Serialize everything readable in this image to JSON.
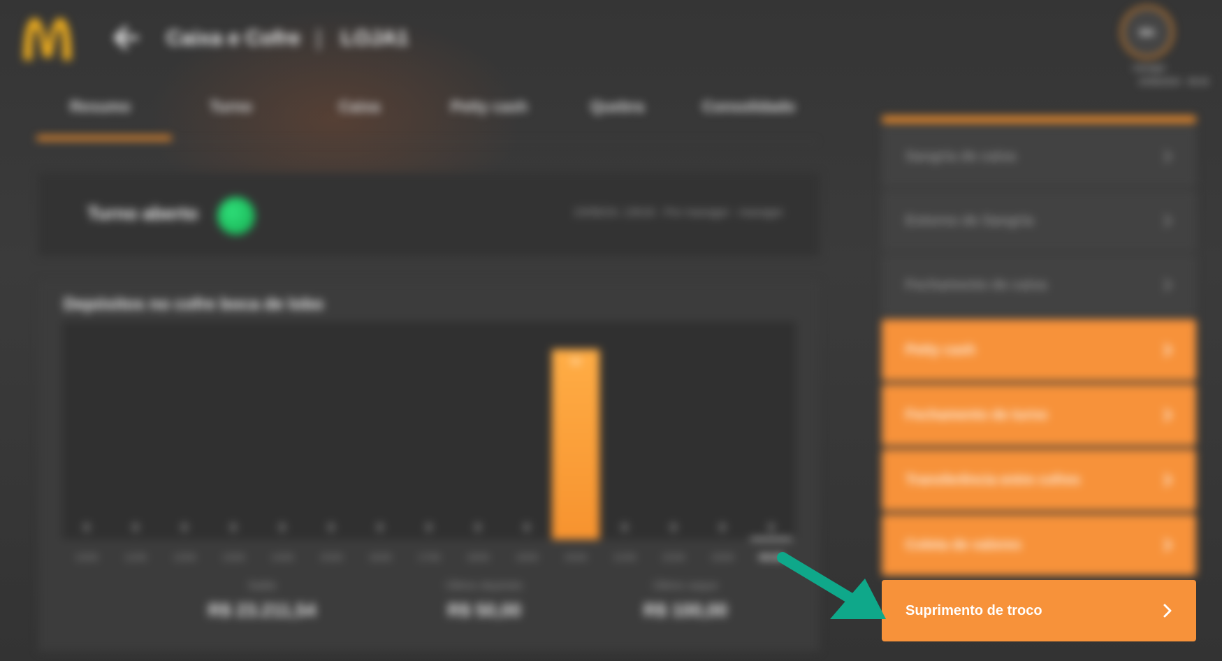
{
  "header": {
    "title": "Caixa e Cofre",
    "separator": "|",
    "store": "LOJA1",
    "user_initials": "MA",
    "user_role": "manager",
    "user_datetime": "23/06/2024 · 09:30"
  },
  "tabs": [
    "Resumo",
    "Turno",
    "Caixa",
    "Petty cash",
    "Quebra",
    "Consolidado"
  ],
  "active_tab": "Resumo",
  "shift": {
    "label": "Turno aberto",
    "info": "23/06/24, 13h16 - Por manager - manager"
  },
  "chart_card": {
    "title": "Depósitos no cofre boca de lobo",
    "stats": [
      {
        "label": "Saldo",
        "value": "R$ 23.211,54"
      },
      {
        "label": "Último depósito",
        "value": "R$ 50,00"
      },
      {
        "label": "Último saque",
        "value": "R$ 100,00"
      }
    ]
  },
  "chart_data": {
    "type": "bar",
    "categories": [
      "10/06",
      "11/06",
      "12/06",
      "13/06",
      "14/06",
      "15/06",
      "16/06",
      "17/06",
      "18/06",
      "19/06",
      "20/06",
      "21/06",
      "22/06",
      "23/06",
      "HOJE"
    ],
    "values": [
      0,
      0,
      0,
      0,
      0,
      0,
      0,
      0,
      0,
      0,
      50,
      0,
      0,
      0,
      0
    ],
    "bar_color": "#f7932f"
  },
  "menu": {
    "accent_color": "#e98a2c",
    "items": [
      {
        "label": "Sangria de caixa",
        "style": "grey"
      },
      {
        "label": "Estorno de Sangria",
        "style": "grey"
      },
      {
        "label": "Fechamento de caixa",
        "style": "grey"
      },
      {
        "label": "Petty cash",
        "style": "orange"
      },
      {
        "label": "Fechamento de turno",
        "style": "orange"
      },
      {
        "label": "Transferência entre cofres",
        "style": "orange"
      },
      {
        "label": "Coleta de valores",
        "style": "orange"
      },
      {
        "label": "Suprimento de troco",
        "style": "highlight"
      }
    ]
  },
  "callout_color": "#0fa88a"
}
